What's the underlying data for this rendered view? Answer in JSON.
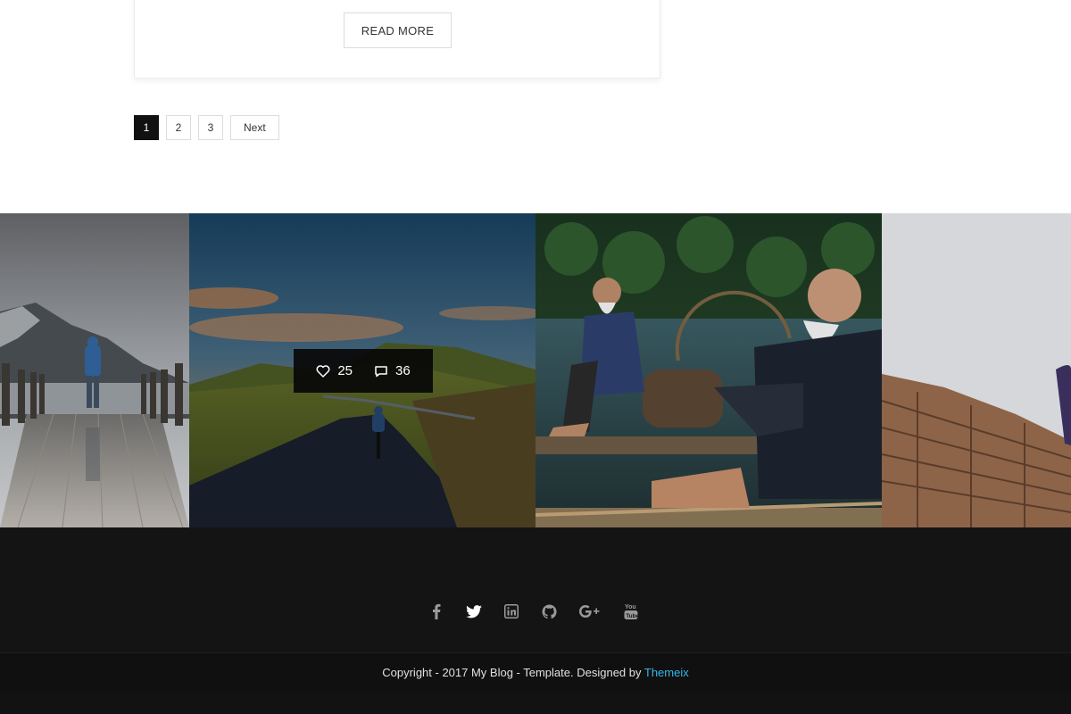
{
  "post": {
    "read_more_label": "READ MORE"
  },
  "pagination": {
    "pages": [
      "1",
      "2",
      "3"
    ],
    "active_page": "1",
    "next_label": "Next"
  },
  "gallery": {
    "overlay": {
      "likes": "25",
      "comments": "36"
    },
    "tiles": [
      {
        "name": "gallery-tile-pier"
      },
      {
        "name": "gallery-tile-cyclist"
      },
      {
        "name": "gallery-tile-fishermen"
      },
      {
        "name": "gallery-tile-wall"
      }
    ]
  },
  "footer": {
    "socials": [
      "facebook-icon",
      "twitter-icon",
      "linkedin-icon",
      "github-icon",
      "google-plus-icon",
      "youtube-icon"
    ],
    "copyright_text": "Copyright - 2017 My Blog - Template. Designed by",
    "designer_link": "Themeix",
    "link_color": "#35b6e8"
  }
}
